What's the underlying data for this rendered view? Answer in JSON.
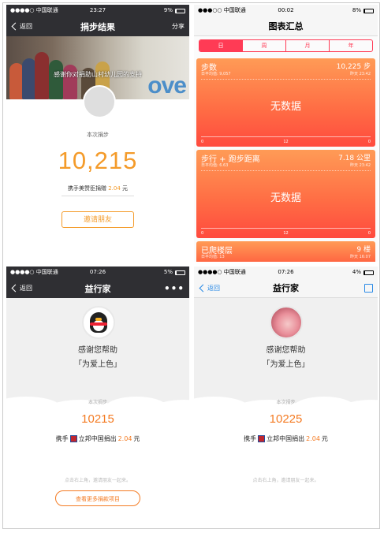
{
  "p1": {
    "status": {
      "carrier": "●●●●○ 中国联通",
      "time": "23:27",
      "battery": "9%"
    },
    "nav": {
      "back": "返回",
      "title": "捐步结果",
      "action": "分享"
    },
    "banner_text": "感谢你对捐助山村幼儿园的支持",
    "banner_sign": "ove",
    "label": "本次捐步",
    "steps": "10,215",
    "sub_prefix": "携手美赞臣捐赠",
    "amount": "2.04",
    "unit": "元",
    "button": "邀请朋友"
  },
  "p2": {
    "status": {
      "carrier": "●●●○○ 中国联通",
      "time": "00:02",
      "battery": "8%"
    },
    "title": "图表汇总",
    "tabs": [
      "日",
      "周",
      "月",
      "年"
    ],
    "cards": [
      {
        "title": "步数",
        "sub": "日平均值: 9,057",
        "value": "10,225 步",
        "date": "昨天 23:42",
        "empty": "无数据",
        "ticks": [
          "0",
          "12",
          "0"
        ]
      },
      {
        "title": "步行 + 跑步距离",
        "sub": "日平均值: 6.63",
        "value": "7.18 公里",
        "date": "昨天 23:42",
        "empty": "无数据",
        "ticks": [
          "0",
          "12",
          "0"
        ]
      },
      {
        "title": "已爬楼层",
        "sub": "日平均值: 13",
        "value": "9 楼",
        "date": "昨天 16:07"
      }
    ]
  },
  "p3": {
    "status": {
      "carrier": "●●●●○ 中国联通",
      "time": "07:26",
      "battery": "5%"
    },
    "nav": {
      "back": "返回",
      "title": "益行家",
      "more": "•••"
    },
    "thanks1": "感谢您帮助",
    "thanks2": "「为爱上色」",
    "label": "本次捐步",
    "steps": "10215",
    "prefix": "携手",
    "sponsor": "立邦中国捐出",
    "amount": "2.04",
    "unit": "元",
    "hint": "点击右上角，邀请朋友一起来。",
    "button": "查看更多捐款项目"
  },
  "p4": {
    "status": {
      "carrier": "●●●●○ 中国联通",
      "time": "07:26",
      "battery": "4%"
    },
    "nav": {
      "back": "返回",
      "title": "益行家"
    },
    "thanks1": "感谢您帮助",
    "thanks2": "「为爱上色」",
    "label": "本次捐步",
    "steps": "10225",
    "prefix": "携手",
    "sponsor": "立邦中国捐出",
    "amount": "2.04",
    "unit": "元",
    "hint": "点击右上角，邀请朋友一起来。"
  },
  "icons": [
    "back-chevron-icon",
    "wifi-icon",
    "location-icon",
    "alarm-icon",
    "battery-icon",
    "share-icon",
    "qq-avatar-icon",
    "nippon-logo-icon"
  ],
  "colors": {
    "orange": "#f49b2a",
    "accent_red": "#ff3b55",
    "link_blue": "#2a8ae6",
    "dark_bar": "#2f2f33"
  }
}
